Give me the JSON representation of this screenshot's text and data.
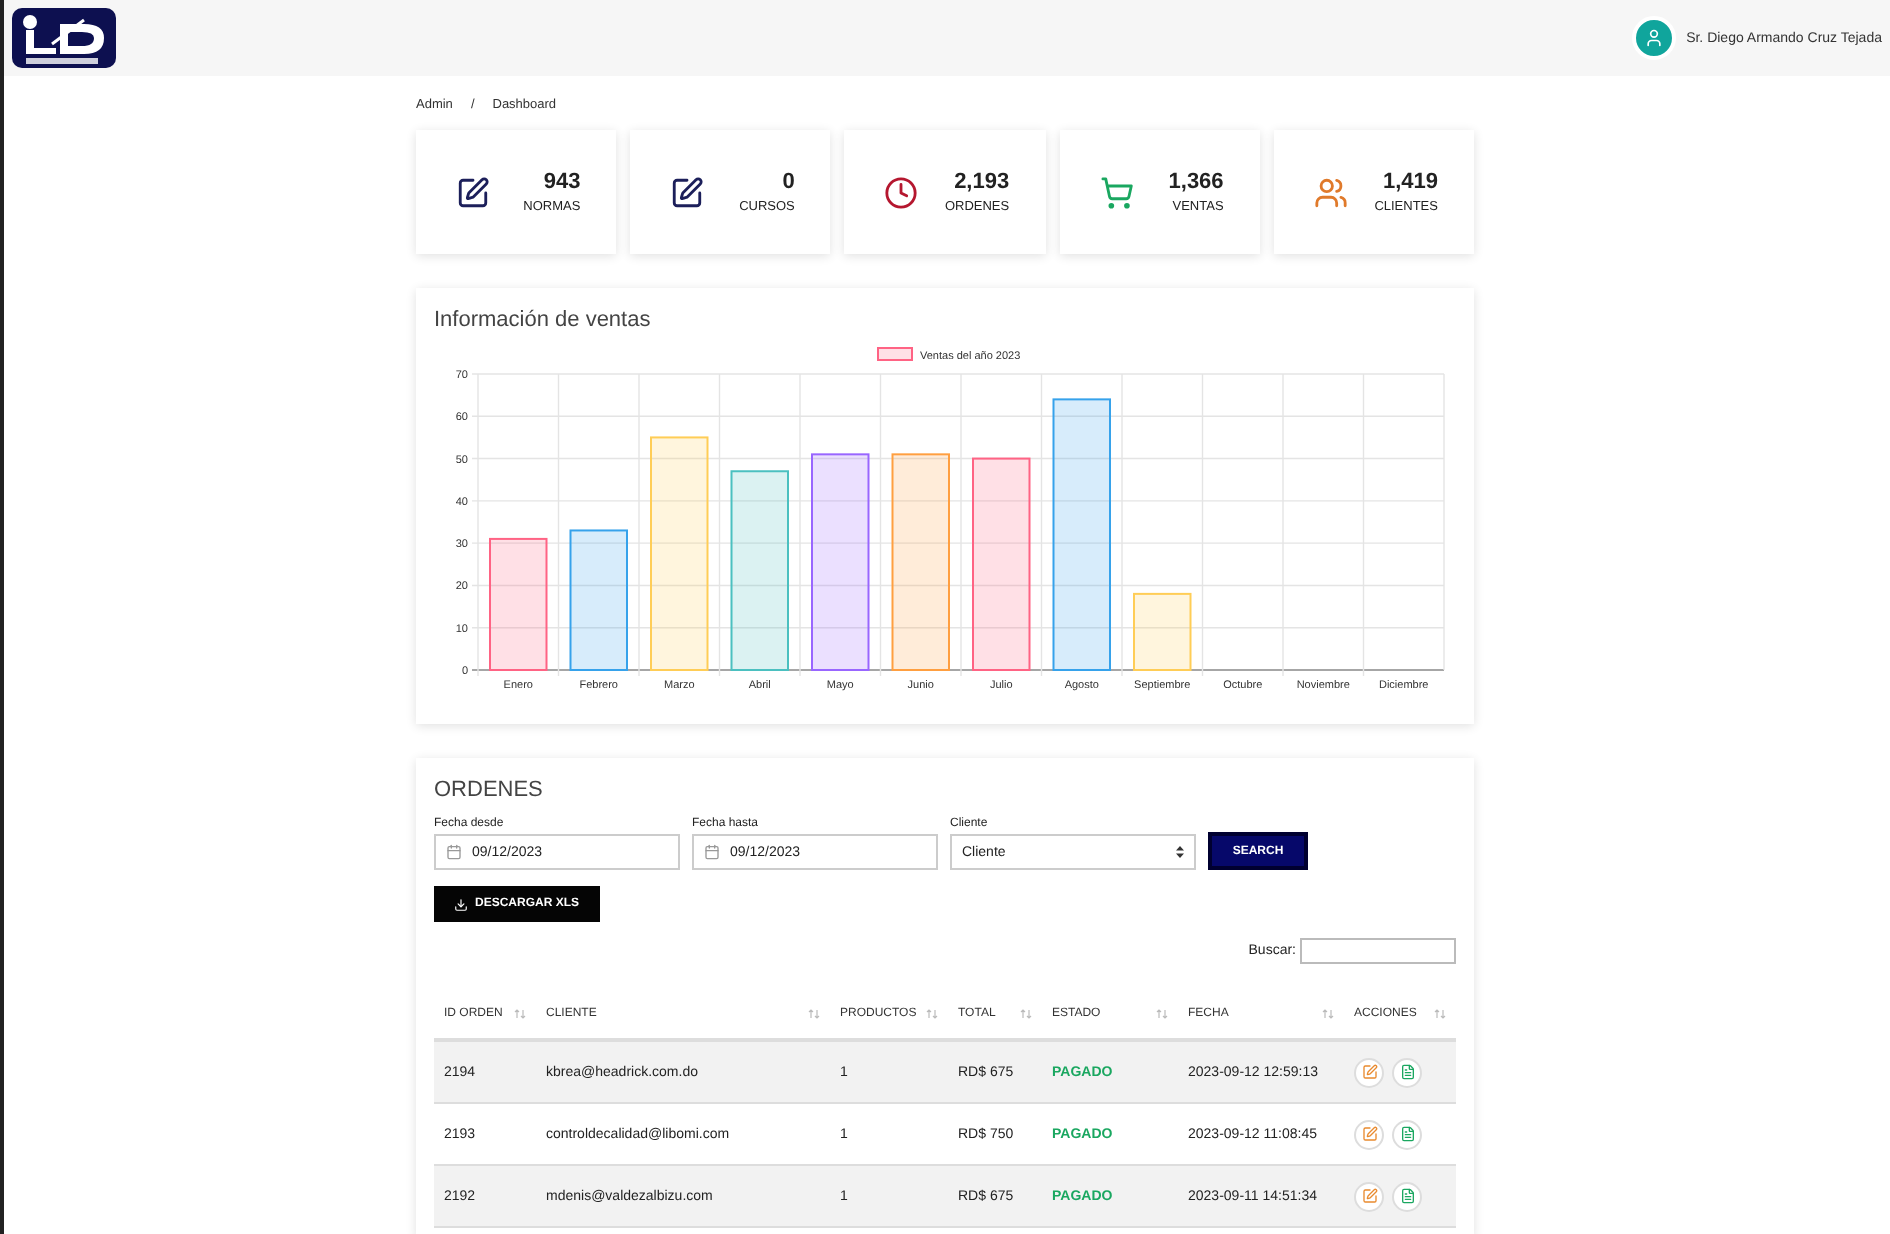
{
  "header": {
    "user_name": "Sr. Diego Armando Cruz Tejada"
  },
  "breadcrumb": [
    "Admin",
    "/",
    "Dashboard"
  ],
  "stats": [
    {
      "kind": "normas",
      "value": "943",
      "label": "NORMAS"
    },
    {
      "kind": "cursos",
      "value": "0",
      "label": "CURSOS"
    },
    {
      "kind": "ordenes",
      "value": "2,193",
      "label": "ORDENES"
    },
    {
      "kind": "ventas",
      "value": "1,366",
      "label": "VENTAS"
    },
    {
      "kind": "clientes",
      "value": "1,419",
      "label": "CLIENTES"
    }
  ],
  "sales": {
    "title": "Información de ventas",
    "chart_data": {
      "type": "bar",
      "categories": [
        "Enero",
        "Febrero",
        "Marzo",
        "Abril",
        "Mayo",
        "Junio",
        "Julio",
        "Agosto",
        "Septiembre",
        "Octubre",
        "Noviembre",
        "Diciembre"
      ],
      "series": [
        {
          "name": "Ventas del año 2023",
          "color": "#ff6384",
          "colors": [
            "#ff6384",
            "#36a2eb",
            "#ffcd56",
            "#4bc0c0",
            "#9966ff",
            "#ff9f40",
            "#ff6384",
            "#36a2eb",
            "#ffcd56",
            "#4bc0c0",
            "#9966ff",
            "#ff9f40"
          ],
          "values": [
            31,
            33,
            55,
            47,
            51,
            51,
            50,
            64,
            18,
            0,
            0,
            0
          ]
        }
      ],
      "grid": true,
      "ylim": [
        0,
        70
      ],
      "yticks": [
        0,
        10,
        20,
        30,
        40,
        50,
        60,
        70
      ]
    }
  },
  "orders": {
    "title": "ORDENES",
    "filters": [
      {
        "kind": "date",
        "label": "Fecha desde",
        "value": "09/12/2023"
      },
      {
        "kind": "date",
        "label": "Fecha hasta",
        "value": "09/12/2023"
      },
      {
        "kind": "select",
        "label": "Cliente",
        "value": "Cliente"
      }
    ],
    "search_button": "SEARCH",
    "download_button": "DESCARGAR XLS",
    "search_label": "Buscar:",
    "columns": [
      "ID ORDEN",
      "CLIENTE",
      "PRODUCTOS",
      "TOTAL",
      "ESTADO",
      "FECHA",
      "ACCIONES"
    ],
    "rows": [
      {
        "id": "2194",
        "client": "kbrea@headrick.com.do",
        "products": "1",
        "total": "RD$ 675",
        "status": "PAGADO",
        "date": "2023-09-12 12:59:13"
      },
      {
        "id": "2193",
        "client": "controldecalidad@libomi.com",
        "products": "1",
        "total": "RD$ 750",
        "status": "PAGADO",
        "date": "2023-09-12 11:08:45"
      },
      {
        "id": "2192",
        "client": "mdenis@valdezalbizu.com",
        "products": "1",
        "total": "RD$ 675",
        "status": "PAGADO",
        "date": "2023-09-11 14:51:34"
      }
    ]
  }
}
